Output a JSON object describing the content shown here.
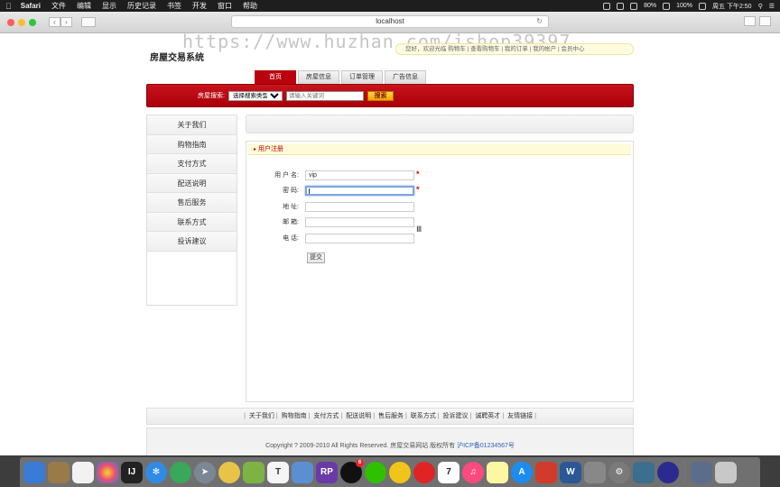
{
  "menubar": {
    "app": "Safari",
    "items": [
      "文件",
      "编辑",
      "显示",
      "历史记录",
      "书签",
      "开发",
      "窗口",
      "帮助"
    ],
    "battery": "80%",
    "battery2": "100%",
    "clock": "周五 下午2:50"
  },
  "browser": {
    "url": "localhost"
  },
  "page": {
    "site_title": "房屋交易系统",
    "watermark": "https://www.huzhan.com/ishop39397",
    "top_links": "您好，欢迎光临  购物车  |  查看购物车  |  我的订单  |  我的帐户  |  会员中心",
    "nav_tabs": [
      {
        "label": "首页",
        "active": true
      },
      {
        "label": "房屋信息",
        "active": false
      },
      {
        "label": "订单管理",
        "active": false
      },
      {
        "label": "广告信息",
        "active": false
      }
    ],
    "search": {
      "label": "房屋搜索:",
      "type_select": "选择搜索类型",
      "placeholder": "请输入关键词",
      "button": "搜索"
    },
    "sidebar": [
      "关于我们",
      "购物指南",
      "支付方式",
      "配送说明",
      "售后服务",
      "联系方式",
      "投诉建议"
    ],
    "panel_title": "用户注册",
    "form": {
      "username_label": "用 户 名:",
      "username_value": "vip",
      "password_label": "密  码:",
      "password_value": "",
      "address_label": "地  址:",
      "address_value": "",
      "email_label": "邮  箱:",
      "email_value": "",
      "phone_label": "电  话:",
      "phone_value": "",
      "required_mark": "*",
      "submit": "提交"
    },
    "footer_links": [
      "关于我们",
      "购物指南",
      "支付方式",
      "配送说明",
      "售后服务",
      "联系方式",
      "投诉建议",
      "诚聘英才",
      "友情链接"
    ],
    "copyright": "Copyright ? 2009-2010 All Rights Reserved. 房屋交易网站 版权所有",
    "icp": "沪ICP备01234567号"
  },
  "dock": {
    "calendar_day": "7",
    "qq_badge": "6"
  },
  "colors": {
    "brand_red": "#b9020d",
    "search_button": "#f0a400",
    "panel_head_bg": "#fffbd9"
  }
}
